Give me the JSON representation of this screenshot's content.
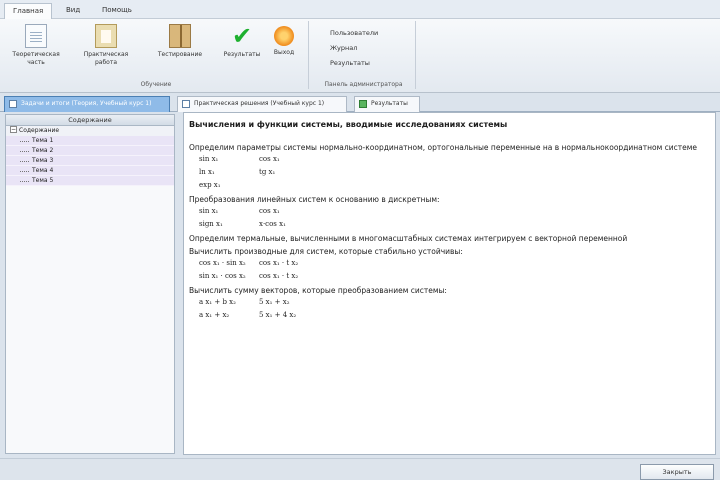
{
  "menu": {
    "tabs": [
      "Главная",
      "Вид",
      "Помощь"
    ]
  },
  "ribbon": {
    "buttons": [
      {
        "label": "Теоретическая часть",
        "icon": "document-icon"
      },
      {
        "label": "Практическая работа",
        "icon": "clipboard-icon"
      },
      {
        "label": "Тестирование",
        "icon": "book-icon"
      },
      {
        "label": "Результаты",
        "icon": "checkmark-icon"
      },
      {
        "label": "Выход",
        "icon": "exit-icon"
      }
    ],
    "group1_label": "Обучение",
    "links": [
      "Пользователи",
      "Журнал",
      "Результаты"
    ],
    "group2_label": "Панель администратора"
  },
  "tabs": [
    {
      "label": "Задачи и итоги (Теория, Учебный курс 1)",
      "active": true
    },
    {
      "label": "Практическая решения (Учебный курс 1)",
      "active": false
    },
    {
      "label": "Результаты",
      "active": false
    }
  ],
  "tree": {
    "header": "Содержание",
    "root": "Содержание",
    "items": [
      "Тема 1",
      "Тема 2",
      "Тема 3",
      "Тема 4",
      "Тема 5"
    ]
  },
  "content": {
    "title": "Вычисления и функции системы, вводимые исследованиях системы",
    "sections": [
      {
        "title": "Определим параметры системы нормально-координатном, ортогональные переменные на в нормальнокоординатном системе",
        "rows": [
          [
            "sin x₁",
            "cos x₁"
          ],
          [
            "ln x₁",
            "tg x₁"
          ],
          [
            "exp x₁",
            ""
          ]
        ]
      },
      {
        "title": "Преобразования линейных систем к основанию в дискретным:",
        "rows": [
          [
            "sin x₁",
            "cos x₁"
          ],
          [
            "sign x₁",
            "x·cos x₁"
          ]
        ]
      },
      {
        "title": "Определим термальные, вычисленными в многомасштабных системах интегрируем с векторной переменной",
        "rows": []
      },
      {
        "title": "Вычислить производные для систем, которые стабильно устойчивы:",
        "rows": [
          [
            "cos x₁ · sin x₂",
            "cos x₁ · t x₂"
          ],
          [
            "sin x₁ · cos x₂",
            "cos x₁ · t x₂"
          ]
        ]
      },
      {
        "title": "Вычислить сумму векторов, которые преобразованием системы:",
        "rows": [
          [
            "a x₁ + b x₂",
            "5 x₁ + x₂"
          ],
          [
            "a x₁ + x₂",
            "5 x₁ + 4 x₂"
          ]
        ]
      }
    ]
  },
  "status": {
    "next_label": "Закрыть"
  }
}
